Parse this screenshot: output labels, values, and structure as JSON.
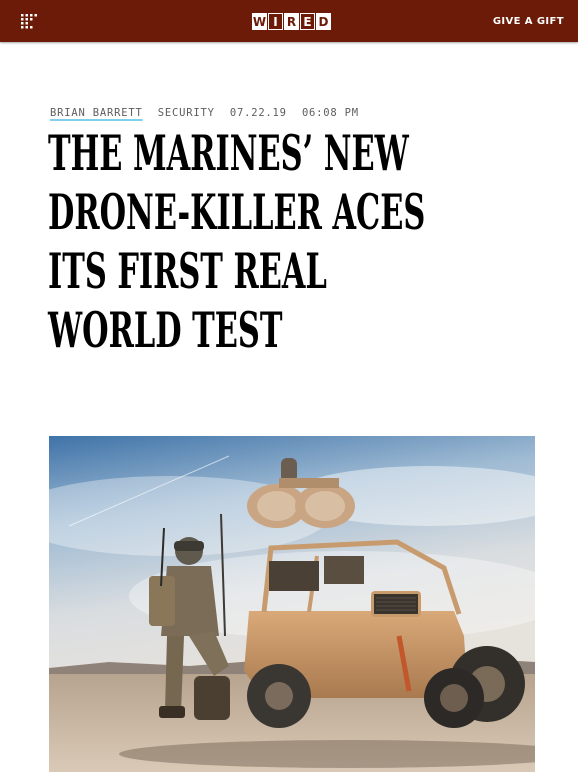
{
  "header": {
    "logo_letters": [
      "W",
      "I",
      "R",
      "E",
      "D"
    ],
    "gift_label": "GIVE A GIFT",
    "menu_icon": "grid-menu-icon",
    "bg_color": "#6b1b07"
  },
  "article": {
    "author": "BRIAN BARRETT",
    "section": "SECURITY",
    "date": "07.22.19",
    "time": "06:08 PM",
    "headline_lines": [
      "THE MARINES’ NEW",
      "DRONE-KILLER ACES",
      "ITS FIRST REAL",
      "WORLD TEST"
    ]
  },
  "hero": {
    "icon": "marine-with-drone-defense-vehicle-photo"
  }
}
